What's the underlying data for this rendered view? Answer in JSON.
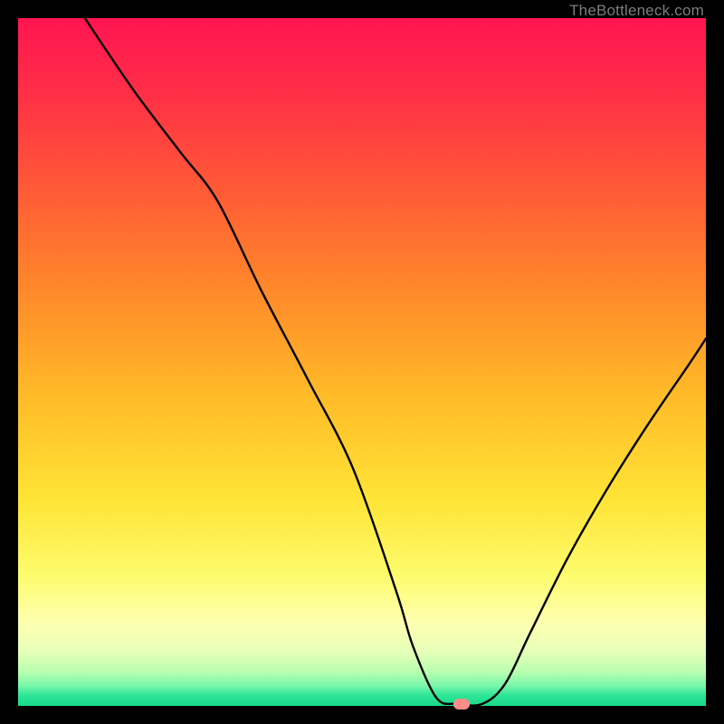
{
  "watermark": "TheBottleneck.com",
  "chart_data": {
    "type": "line",
    "title": "",
    "xlabel": "",
    "ylabel": "",
    "xlim": [
      0,
      100
    ],
    "ylim": [
      0,
      100
    ],
    "series": [
      {
        "name": "curve",
        "x": [
          9.7,
          16.8,
          23.6,
          29.0,
          35.3,
          42.1,
          48.7,
          55.0,
          57.4,
          60.8,
          63.8,
          67.5,
          70.8,
          74.4,
          79.8,
          85.5,
          91.5,
          97.7,
          100.0
        ],
        "values": [
          100.0,
          89.5,
          80.5,
          73.4,
          60.5,
          47.5,
          34.5,
          16.6,
          8.7,
          1.2,
          0.3,
          0.3,
          3.2,
          10.5,
          21.3,
          31.3,
          40.8,
          49.9,
          53.4
        ]
      }
    ],
    "marker": {
      "x": 64.5,
      "y": 0.3
    },
    "background": "heat-gradient",
    "colors": {
      "curve": "#000000",
      "marker": "#ff8d8a",
      "gradient_top": "#ff1551",
      "gradient_bottom": "#18d988"
    }
  }
}
